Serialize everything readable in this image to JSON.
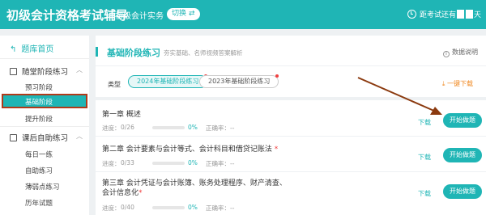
{
  "header": {
    "app_title": "初级会计资格考试辅导",
    "subject": "初级会计实务",
    "switch_label": "切换",
    "switch_icon": "swap-icon",
    "countdown_prefix": "距考试还有",
    "countdown_suffix": "天"
  },
  "sidebar": {
    "home": "题库首页",
    "group1": {
      "label": "随堂阶段练习",
      "items": [
        "预习阶段",
        "基础阶段",
        "提升阶段"
      ]
    },
    "group2": {
      "label": "课后自助练习",
      "items": [
        "每日一练",
        "自助练习",
        "薄弱点练习",
        "历年试题"
      ]
    }
  },
  "main": {
    "section_title": "基础阶段练习",
    "section_subtitle": "夯实基础、名师视频答案解析",
    "data_note": "数据说明",
    "type_label": "类型",
    "type_tabs": [
      "2024年基础阶段练习",
      "2023年基础阶段练习"
    ],
    "download_all": "一键下载",
    "progress_label": "进度：",
    "accuracy_label": "正确率：--",
    "download_label": "下载",
    "start_label": "开始做题",
    "chapters": [
      {
        "title": "第一章 概述",
        "required": false,
        "count": "0/26",
        "pct": "0%"
      },
      {
        "title": "第二章 会计要素与会计等式、会计科目和借贷记账法",
        "required": true,
        "count": "0/33",
        "pct": "0%"
      },
      {
        "title": "第三章 会计凭证与会计账簿、账务处理程序、财产清查、会计信息化",
        "required": true,
        "count": "0/40",
        "pct": "0%"
      }
    ]
  },
  "colors": {
    "accent": "#1fb5b5",
    "highlight_border": "#b03a1a",
    "warning": "#f08a24",
    "required": "#f04040"
  }
}
